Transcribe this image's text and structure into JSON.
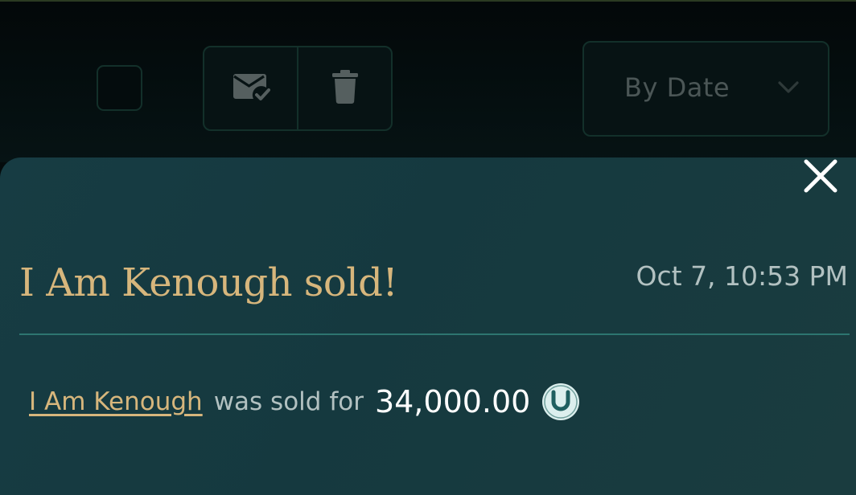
{
  "toolbar": {
    "sort": {
      "label": "By Date"
    },
    "icons": {
      "mark_read": "mail-check-icon",
      "delete": "trash-icon",
      "sort_chevron": "chevron-down-icon"
    }
  },
  "notification": {
    "title": "I Am Kenough sold!",
    "timestamp": "Oct 7, 10:53 PM",
    "item_name": "I Am Kenough",
    "message_text": "was sold for",
    "price": "34,000.00",
    "currency_icon": "horseshoe-coin-icon",
    "close_icon": "close-icon"
  },
  "colors": {
    "accent_gold": "#d7b67c",
    "panel_teal": "#173c43",
    "divider": "#2d7570",
    "muted_text": "#b2c1c1"
  }
}
